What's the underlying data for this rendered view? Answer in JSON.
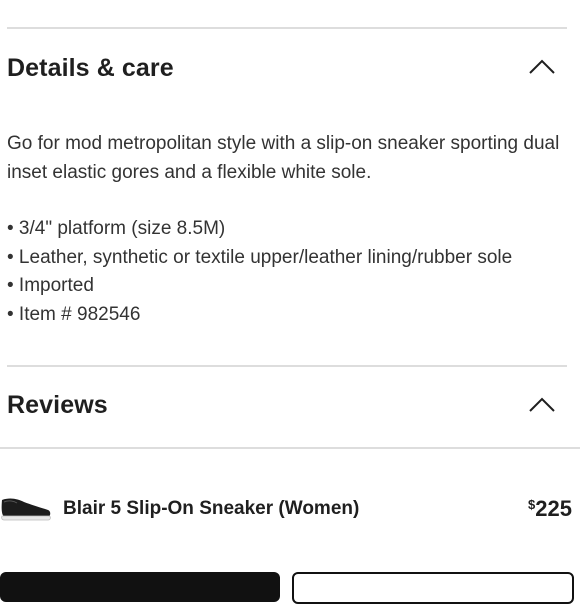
{
  "details_section": {
    "title": "Details & care",
    "chevron_icon": "chevron-up-icon",
    "description": "Go for mod metropolitan style with a slip-on sneaker sporting dual inset elastic gores and a flexible white sole.",
    "bullets": [
      "• 3/4\" platform (size 8.5M)",
      "• Leather, synthetic or textile upper/leather lining/rubber sole",
      "• Imported",
      "• Item # 982546"
    ]
  },
  "reviews_section": {
    "title": "Reviews",
    "chevron_icon": "chevron-up-icon"
  },
  "product": {
    "name": "Blair 5 Slip-On Sneaker (Women)",
    "currency_symbol": "$",
    "price": "225",
    "image_icon": "shoe-thumbnail"
  },
  "colors": {
    "divider": "#dddddd",
    "text": "#333333",
    "heading": "#1f1f1f",
    "button_dark": "#111111"
  }
}
